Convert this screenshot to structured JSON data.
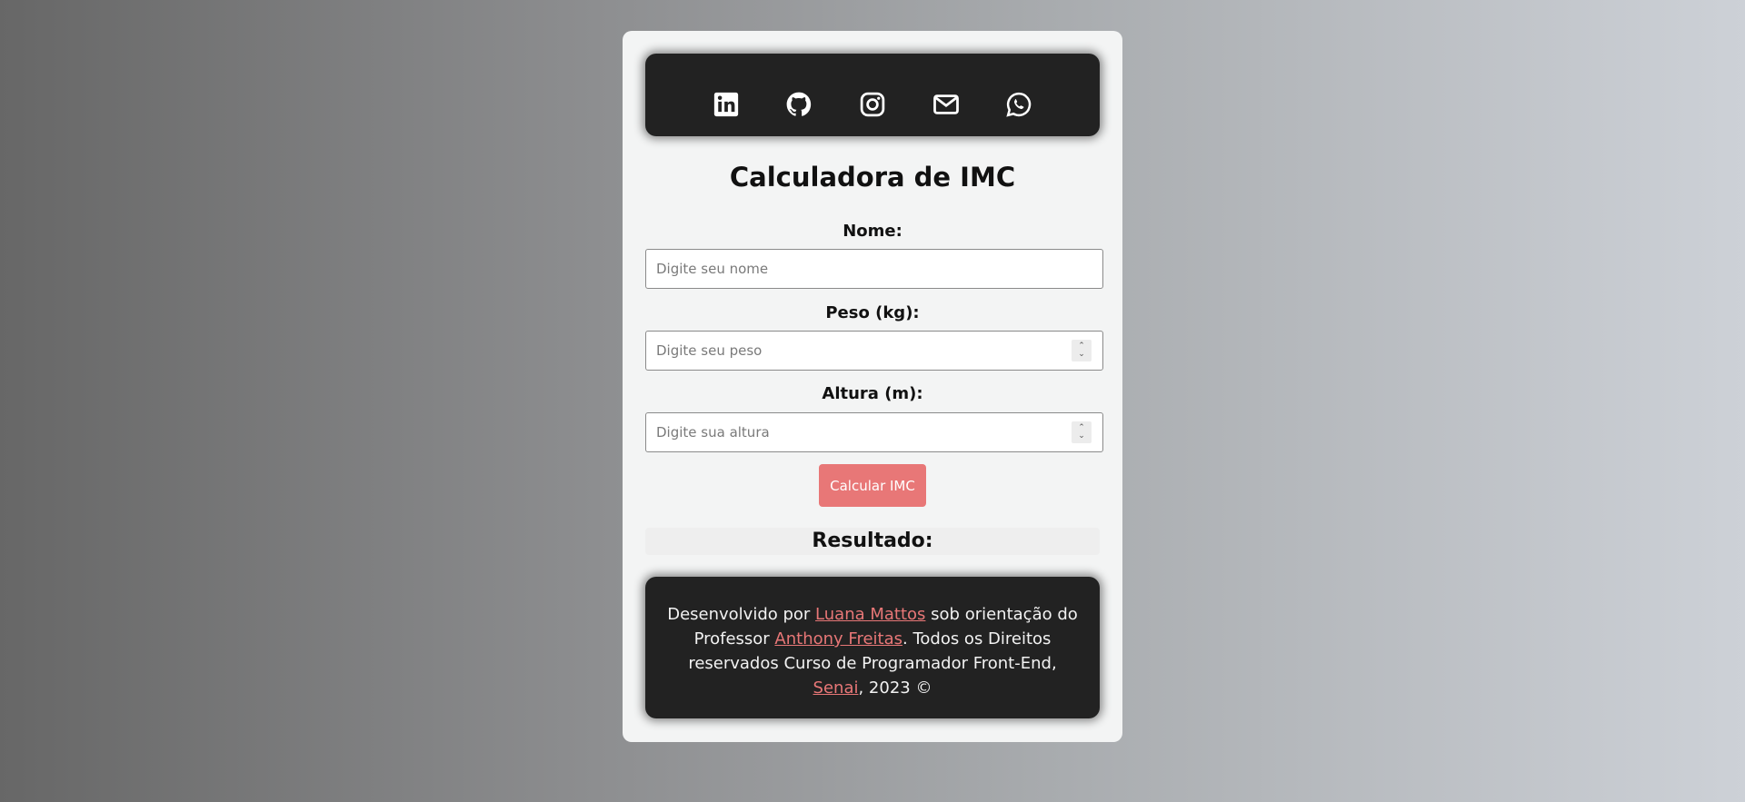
{
  "social": [
    {
      "name": "linkedin-icon",
      "label": "LinkedIn"
    },
    {
      "name": "github-icon",
      "label": "GitHub"
    },
    {
      "name": "instagram-icon",
      "label": "Instagram"
    },
    {
      "name": "email-icon",
      "label": "E-mail"
    },
    {
      "name": "whatsapp-icon",
      "label": "WhatsApp"
    }
  ],
  "title": "Calculadora de IMC",
  "form": {
    "name_label": "Nome:",
    "name_placeholder": "Digite seu nome",
    "weight_label": "Peso (kg):",
    "weight_placeholder": "Digite seu peso",
    "height_label": "Altura (m):",
    "height_placeholder": "Digite sua altura",
    "submit_label": "Calcular IMC"
  },
  "result": {
    "label": "Resultado:"
  },
  "footer": {
    "text_1": "Desenvolvido por ",
    "author": "Luana Mattos",
    "text_2": " sob orientação do Professor ",
    "professor": "Anthony Freitas",
    "text_3": ". Todos os Direitos reservados Curso de Programador Front-End, ",
    "institution": "Senai",
    "text_4": ", 2023 ©"
  },
  "colors": {
    "accent": "#e87777",
    "dark_panel": "#222222",
    "card": "#f3f4f4"
  }
}
